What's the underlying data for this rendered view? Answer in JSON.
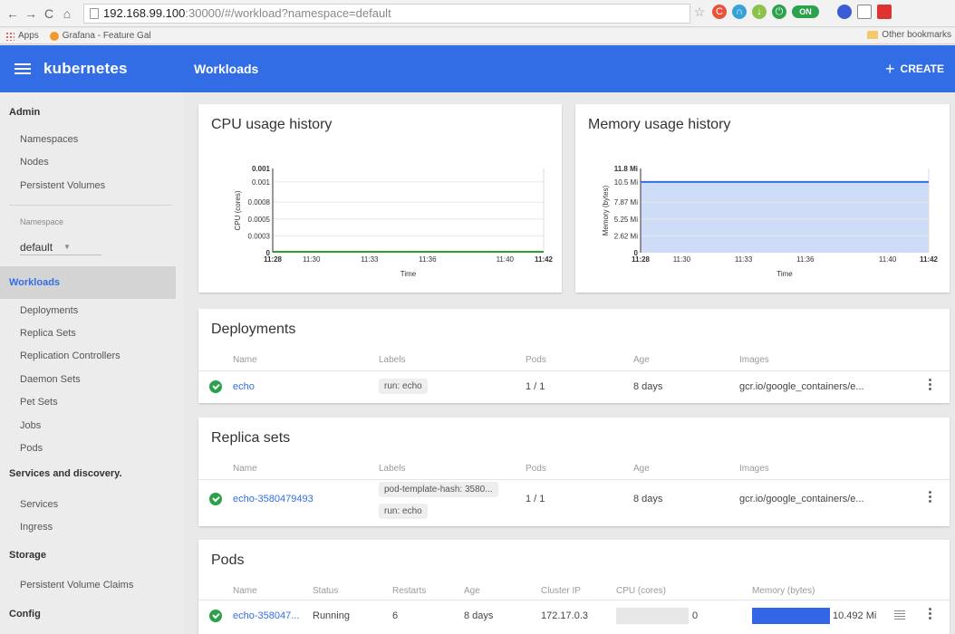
{
  "browser": {
    "url_host": "192.168.99.100",
    "url_path": ":30000/#/workload?namespace=default",
    "bookmarks": [
      "Apps",
      "Grafana - Feature Gal"
    ],
    "other_bookmarks": "Other bookmarks",
    "ext_on_label": "ON"
  },
  "header": {
    "brand": "kubernetes",
    "title": "Workloads",
    "create_label": "CREATE",
    "color": "#326de6"
  },
  "sidebar": {
    "admin": "Admin",
    "admin_items": [
      "Namespaces",
      "Nodes",
      "Persistent Volumes"
    ],
    "namespace_label": "Namespace",
    "namespace_value": "default",
    "workloads": "Workloads",
    "workload_items": [
      "Deployments",
      "Replica Sets",
      "Replication Controllers",
      "Daemon Sets",
      "Pet Sets",
      "Jobs",
      "Pods"
    ],
    "services": "Services and discovery.",
    "service_items": [
      "Services",
      "Ingress"
    ],
    "storage": "Storage",
    "storage_items": [
      "Persistent Volume Claims"
    ],
    "config": "Config"
  },
  "cpu_card": {
    "title": "CPU usage history"
  },
  "memory_card": {
    "title": "Memory usage history"
  },
  "chart_data": [
    {
      "type": "line",
      "title": "CPU usage history",
      "xlabel": "Time",
      "ylabel": "CPU (cores)",
      "y_ticks": [
        "0",
        "0.0003",
        "0.0005",
        "0.0008",
        "0.001",
        "0.001"
      ],
      "x_ticks": [
        "11:28",
        "11:30",
        "11:33",
        "11:36",
        "11:40",
        "11:42"
      ],
      "x": [
        "11:28",
        "11:42"
      ],
      "values": [
        0,
        0
      ],
      "color": "#2ca02c"
    },
    {
      "type": "area",
      "title": "Memory usage history",
      "xlabel": "Time",
      "ylabel": "Memory (bytes)",
      "y_ticks": [
        "0",
        "2.62 Mi",
        "5.25 Mi",
        "7.87 Mi",
        "10.5 Mi",
        "11.8 Mi"
      ],
      "x_ticks": [
        "11:28",
        "11:30",
        "11:33",
        "11:36",
        "11:40",
        "11:42"
      ],
      "x": [
        "11:28",
        "11:42"
      ],
      "values": [
        10.5,
        10.5
      ],
      "ylim": [
        0,
        11.8
      ],
      "color": "#326de6"
    }
  ],
  "deployments": {
    "title": "Deployments",
    "headers": [
      "Name",
      "Labels",
      "Pods",
      "Age",
      "Images"
    ],
    "rows": [
      {
        "name": "echo",
        "labels": [
          "run: echo"
        ],
        "pods": "1 / 1",
        "age": "8 days",
        "images": "gcr.io/google_containers/e..."
      }
    ]
  },
  "replica_sets": {
    "title": "Replica sets",
    "headers": [
      "Name",
      "Labels",
      "Pods",
      "Age",
      "Images"
    ],
    "rows": [
      {
        "name": "echo-3580479493",
        "labels": [
          "pod-template-hash: 3580...",
          "run: echo"
        ],
        "pods": "1 / 1",
        "age": "8 days",
        "images": "gcr.io/google_containers/e..."
      }
    ]
  },
  "pods": {
    "title": "Pods",
    "headers": [
      "Name",
      "Status",
      "Restarts",
      "Age",
      "Cluster IP",
      "CPU (cores)",
      "Memory (bytes)"
    ],
    "rows": [
      {
        "name": "echo-358047...",
        "status": "Running",
        "restarts": "6",
        "age": "8 days",
        "cluster_ip": "172.17.0.3",
        "cpu": "0",
        "cpu_fraction": 0,
        "memory": "10.492 Mi",
        "memory_fraction": 1.0
      }
    ]
  }
}
